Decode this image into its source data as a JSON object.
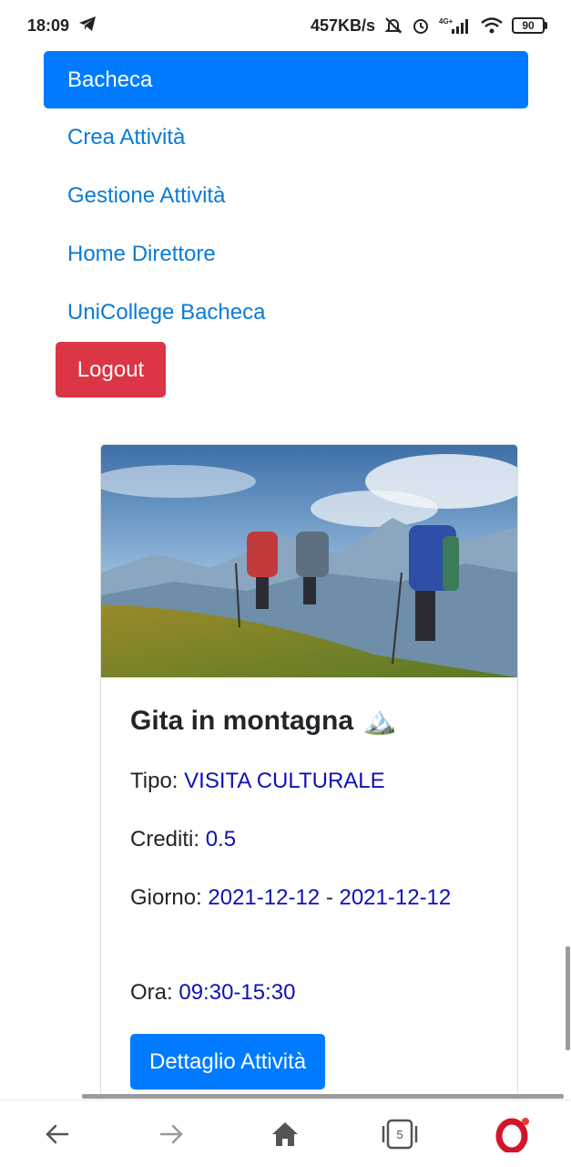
{
  "status_bar": {
    "time": "18:09",
    "network_speed": "457KB/s",
    "network_type": "4G+",
    "battery": "90",
    "icons": [
      "telegram-icon",
      "mute-icon",
      "alarm-icon",
      "signal-icon",
      "wifi-icon",
      "battery-icon"
    ]
  },
  "nav": {
    "active": "Bacheca",
    "links": [
      "Crea Attività",
      "Gestione Attività",
      "Home Direttore",
      "UniCollege Bacheca"
    ],
    "logout": "Logout"
  },
  "card": {
    "title": "Gita in montagna",
    "title_emoji": "🏔️",
    "tipo_label": "Tipo:",
    "tipo_value": "VISITA CULTURALE",
    "crediti_label": "Crediti:",
    "crediti_value": "0.5",
    "giorno_label": "Giorno:",
    "giorno_start": "2021-12-12",
    "giorno_sep": "-",
    "giorno_end": "2021-12-12",
    "ora_label": "Ora:",
    "ora_value": "09:30-15:30",
    "button": "Dettaglio Attività"
  },
  "browser_bar": {
    "tabs_count": "5",
    "icons": [
      "back-icon",
      "forward-icon",
      "home-icon",
      "tabs-icon",
      "opera-icon"
    ]
  },
  "colors": {
    "primary": "#007bff",
    "danger": "#dc3545",
    "link": "#0a7bd8",
    "value": "#1010b8"
  }
}
